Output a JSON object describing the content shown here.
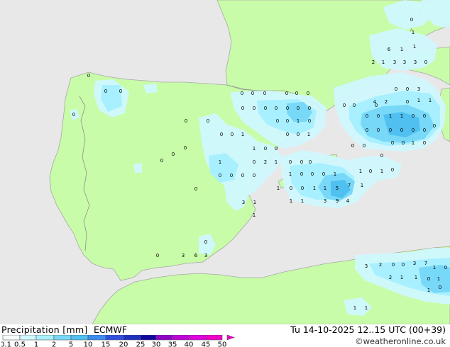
{
  "header": {
    "title": "Precipitation [mm]",
    "model": "ECMWF",
    "valid_time": "Tu 14-10-2025 12..15 UTC (00+39)",
    "credit": "©weatheronline.co.uk"
  },
  "legend": {
    "ticks": [
      "0.1",
      "0.5",
      "1",
      "2",
      "5",
      "10",
      "15",
      "20",
      "25",
      "30",
      "35",
      "40",
      "45",
      "50"
    ],
    "colors": [
      "#f8ffff",
      "#d0f8ff",
      "#a8f0ff",
      "#78d8f8",
      "#50c0f0",
      "#3c8cf0",
      "#3050e0",
      "#2030c0",
      "#1008a0",
      "#9000c8",
      "#c000d8",
      "#e000e0",
      "#f000c8"
    ]
  },
  "colors": {
    "sea": "#e8e8e8",
    "land": "#c8fca8",
    "coast": "#a8a8a8",
    "border": "#909090"
  },
  "map": {
    "values": [
      {
        "v": "0"
      },
      {
        "v": "0"
      },
      {
        "v": "0"
      },
      {
        "v": "0"
      },
      {
        "v": "0"
      },
      {
        "v": "0"
      },
      {
        "v": "0"
      },
      {
        "v": "0"
      },
      {
        "v": "0"
      },
      {
        "v": "0"
      },
      {
        "v": "0"
      },
      {
        "v": "0"
      },
      {
        "v": "0"
      },
      {
        "v": "0"
      },
      {
        "v": "0"
      },
      {
        "v": "0"
      },
      {
        "v": "0"
      },
      {
        "v": "0"
      },
      {
        "v": "0"
      },
      {
        "v": "0"
      },
      {
        "v": "0"
      },
      {
        "v": "0"
      },
      {
        "v": "0"
      },
      {
        "v": "0"
      },
      {
        "v": "1"
      },
      {
        "v": "0"
      },
      {
        "v": "0"
      },
      {
        "v": "0"
      },
      {
        "v": "1"
      },
      {
        "v": "0"
      },
      {
        "v": "0"
      },
      {
        "v": "1"
      },
      {
        "v": "1"
      },
      {
        "v": "0"
      },
      {
        "v": "0"
      },
      {
        "v": "1"
      },
      {
        "v": "0"
      },
      {
        "v": "2"
      },
      {
        "v": "1"
      },
      {
        "v": "0"
      },
      {
        "v": "0"
      },
      {
        "v": "0"
      },
      {
        "v": "0"
      },
      {
        "v": "0"
      },
      {
        "v": "0"
      },
      {
        "v": "0"
      },
      {
        "v": "1"
      },
      {
        "v": "0"
      },
      {
        "v": "0"
      },
      {
        "v": "0"
      },
      {
        "v": "1"
      },
      {
        "v": "1"
      },
      {
        "v": "0"
      },
      {
        "v": "1"
      },
      {
        "v": "0"
      },
      {
        "v": "1"
      },
      {
        "v": "0"
      },
      {
        "v": "0"
      },
      {
        "v": "1"
      },
      {
        "v": "1"
      },
      {
        "v": "5"
      },
      {
        "v": "7"
      },
      {
        "v": "1"
      },
      {
        "v": "3"
      },
      {
        "v": "1"
      },
      {
        "v": "1"
      },
      {
        "v": "1"
      },
      {
        "v": "3"
      },
      {
        "v": "9"
      },
      {
        "v": "4"
      },
      {
        "v": "1"
      },
      {
        "v": "0"
      },
      {
        "v": "0"
      },
      {
        "v": "3"
      },
      {
        "v": "6"
      },
      {
        "v": "3"
      },
      {
        "v": "0"
      },
      {
        "v": "0"
      },
      {
        "v": "0"
      },
      {
        "v": "0"
      },
      {
        "v": "0"
      },
      {
        "v": "0"
      },
      {
        "v": "1"
      },
      {
        "v": "1"
      },
      {
        "v": "0"
      },
      {
        "v": "0"
      },
      {
        "v": "0"
      },
      {
        "v": "0"
      },
      {
        "v": "0"
      },
      {
        "v": "0"
      },
      {
        "v": "0"
      },
      {
        "v": "0"
      },
      {
        "v": "0"
      },
      {
        "v": "0"
      },
      {
        "v": "0"
      },
      {
        "v": "1"
      },
      {
        "v": "0"
      },
      {
        "v": "0"
      },
      {
        "v": "0"
      },
      {
        "v": "0"
      },
      {
        "v": "0"
      },
      {
        "v": "0"
      },
      {
        "v": "3"
      },
      {
        "v": "1"
      },
      {
        "v": "1"
      },
      {
        "v": "0"
      },
      {
        "v": "2"
      },
      {
        "v": "4"
      },
      {
        "v": "6"
      },
      {
        "v": "1"
      },
      {
        "v": "1"
      },
      {
        "v": "0"
      },
      {
        "v": "3"
      },
      {
        "v": "3"
      },
      {
        "v": "3"
      },
      {
        "v": "1"
      },
      {
        "v": "2"
      },
      {
        "v": "3"
      },
      {
        "v": "2"
      },
      {
        "v": "0"
      },
      {
        "v": "0"
      },
      {
        "v": "3"
      },
      {
        "v": "7"
      },
      {
        "v": "1"
      },
      {
        "v": "0"
      },
      {
        "v": "2"
      },
      {
        "v": "1"
      },
      {
        "v": "1"
      },
      {
        "v": "0"
      },
      {
        "v": "1"
      },
      {
        "v": "1"
      },
      {
        "v": "0"
      },
      {
        "v": "1"
      },
      {
        "v": "1"
      },
      {
        "v": "0"
      },
      {
        "v": "1"
      },
      {
        "v": "1"
      },
      {
        "v": "1"
      },
      {
        "v": "0"
      },
      {
        "v": "1"
      }
    ]
  }
}
